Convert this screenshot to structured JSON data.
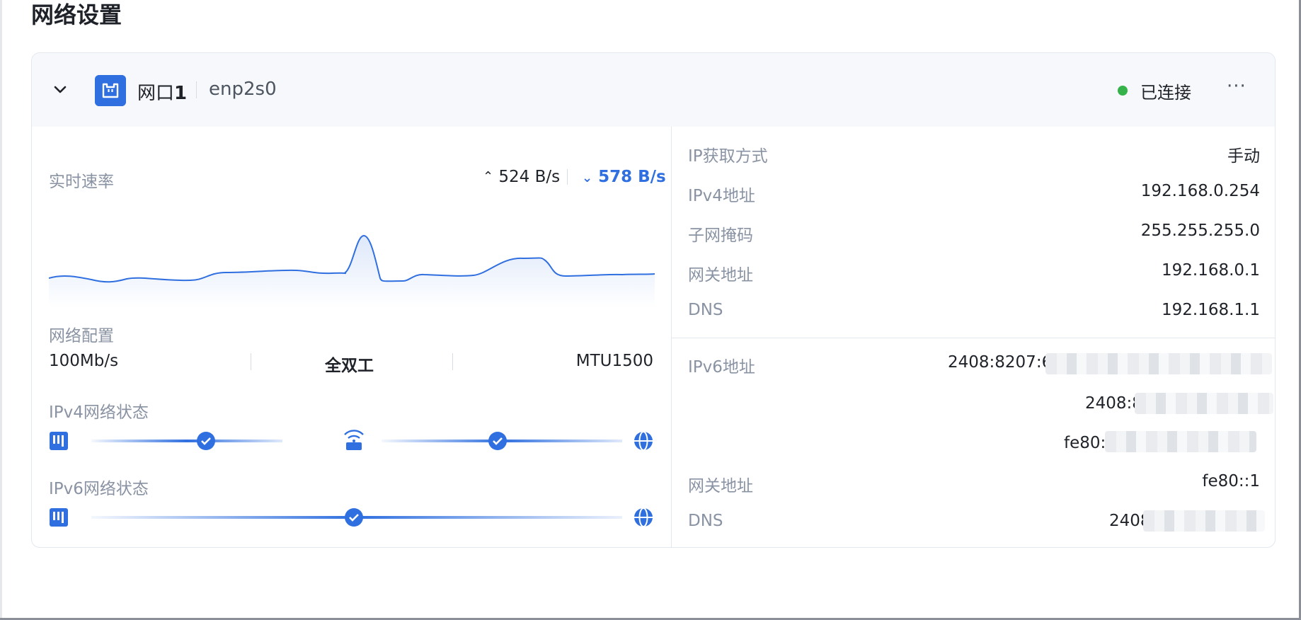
{
  "page": {
    "title": "网络设置"
  },
  "header": {
    "port_label": "网口",
    "port_number": "1",
    "interface": "enp2s0",
    "status": "已连接",
    "more": "···",
    "status_color": "#35b34a"
  },
  "speed": {
    "label": "实时速率",
    "upload": "524 B/s",
    "download": "578 B/s"
  },
  "config": {
    "label": "网络配置",
    "bandwidth": "100Mb/s",
    "duplex": "全双工",
    "mtu": "MTU1500"
  },
  "ipv4_status": {
    "label": "IPv4网络状态"
  },
  "ipv6_status": {
    "label": "IPv6网络状态"
  },
  "info": {
    "ip_method": {
      "key": "IP获取方式",
      "value": "手动"
    },
    "ipv4": {
      "key": "IPv4地址",
      "value": "192.168.0.254"
    },
    "netmask": {
      "key": "子网掩码",
      "value": "255.255.255.0"
    },
    "gateway": {
      "key": "网关地址",
      "value": "192.168.0.1"
    },
    "dns": {
      "key": "DNS",
      "value": "192.168.1.1"
    }
  },
  "info6": {
    "ipv6_key": "IPv6地址",
    "ipv6_values": [
      "2408:8207:6c",
      "2408:8",
      "fe80:"
    ],
    "gateway": {
      "key": "网关地址",
      "value": "fe80::1"
    },
    "dns": {
      "key": "DNS",
      "value": "2408"
    }
  },
  "colors": {
    "accent": "#2f6fe0",
    "muted": "#8a93a3"
  }
}
